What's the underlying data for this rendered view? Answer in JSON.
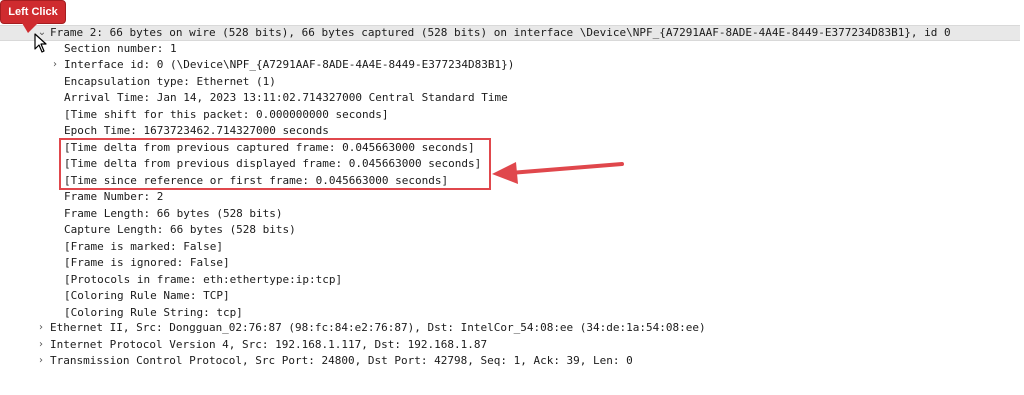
{
  "tooltip": {
    "label": "Left Click"
  },
  "frame": {
    "header": "Frame 2: 66 bytes on wire (528 bits), 66 bytes captured (528 bits) on interface \\Device\\NPF_{A7291AAF-8ADE-4A4E-8449-E377234D83B1}, id 0",
    "expanded": true,
    "fields": [
      {
        "text": "Section number: 1",
        "expandable": false
      },
      {
        "text": "Interface id: 0 (\\Device\\NPF_{A7291AAF-8ADE-4A4E-8449-E377234D83B1})",
        "expandable": true
      },
      {
        "text": "Encapsulation type: Ethernet (1)",
        "expandable": false
      },
      {
        "text": "Arrival Time: Jan 14, 2023 13:11:02.714327000 Central Standard Time",
        "expandable": false
      },
      {
        "text": "[Time shift for this packet: 0.000000000 seconds]",
        "expandable": false
      },
      {
        "text": "Epoch Time: 1673723462.714327000 seconds",
        "expandable": false
      },
      {
        "text": "[Time delta from previous captured frame: 0.045663000 seconds]",
        "expandable": false,
        "highlighted": true
      },
      {
        "text": "[Time delta from previous displayed frame: 0.045663000 seconds]",
        "expandable": false,
        "highlighted": true
      },
      {
        "text": "[Time since reference or first frame: 0.045663000 seconds]",
        "expandable": false,
        "highlighted": true
      },
      {
        "text": "Frame Number: 2",
        "expandable": false
      },
      {
        "text": "Frame Length: 66 bytes (528 bits)",
        "expandable": false
      },
      {
        "text": "Capture Length: 66 bytes (528 bits)",
        "expandable": false
      },
      {
        "text": "[Frame is marked: False]",
        "expandable": false
      },
      {
        "text": "[Frame is ignored: False]",
        "expandable": false
      },
      {
        "text": "[Protocols in frame: eth:ethertype:ip:tcp]",
        "expandable": false
      },
      {
        "text": "[Coloring Rule Name: TCP]",
        "expandable": false
      },
      {
        "text": "[Coloring Rule String: tcp]",
        "expandable": false
      }
    ]
  },
  "protocols": [
    {
      "text": "Ethernet II, Src: Dongguan_02:76:87 (98:fc:84:e2:76:87), Dst: IntelCor_54:08:ee (34:de:1a:54:08:ee)",
      "expandable": true
    },
    {
      "text": "Internet Protocol Version 4, Src: 192.168.1.117, Dst: 192.168.1.87",
      "expandable": true
    },
    {
      "text": "Transmission Control Protocol, Src Port: 24800, Dst Port: 42798, Seq: 1, Ack: 39, Len: 0",
      "expandable": true
    }
  ],
  "colors": {
    "annotation": "#e0474c",
    "tooltip_bg": "#cf2b2f",
    "selected_row": "#e8e8e8"
  },
  "icons": {
    "expanded": "chevron-down-icon",
    "collapsed": "chevron-right-icon",
    "cursor": "mouse-pointer-icon"
  }
}
